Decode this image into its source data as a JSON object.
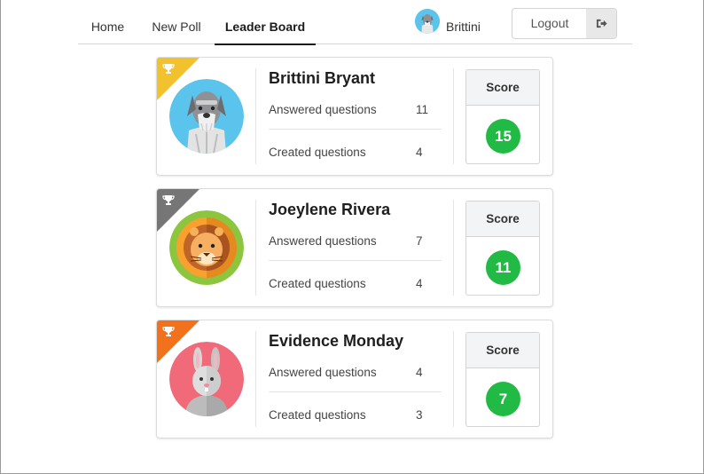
{
  "nav": {
    "items": [
      {
        "label": "Home"
      },
      {
        "label": "New Poll"
      },
      {
        "label": "Leader Board",
        "active": true
      }
    ],
    "user_name": "Brittini",
    "logout_label": "Logout"
  },
  "leaderboard": [
    {
      "name": "Brittini Bryant",
      "answered_label": "Answered questions",
      "answered": "11",
      "created_label": "Created questions",
      "created": "4",
      "score_label": "Score",
      "score": "15",
      "ribbon_color": "#f2c12e",
      "avatar": "schnauzer-dog-avatar"
    },
    {
      "name": "Joeylene Rivera",
      "answered_label": "Answered questions",
      "answered": "7",
      "created_label": "Created questions",
      "created": "4",
      "score_label": "Score",
      "score": "11",
      "ribbon_color": "#767676",
      "avatar": "lion-avatar"
    },
    {
      "name": "Evidence Monday",
      "answered_label": "Answered questions",
      "answered": "4",
      "created_label": "Created questions",
      "created": "3",
      "score_label": "Score",
      "score": "7",
      "ribbon_color": "#f2711c",
      "avatar": "rabbit-avatar"
    }
  ],
  "colors": {
    "score_badge": "#21ba45",
    "active_tab_underline": "#1b1c1d"
  }
}
